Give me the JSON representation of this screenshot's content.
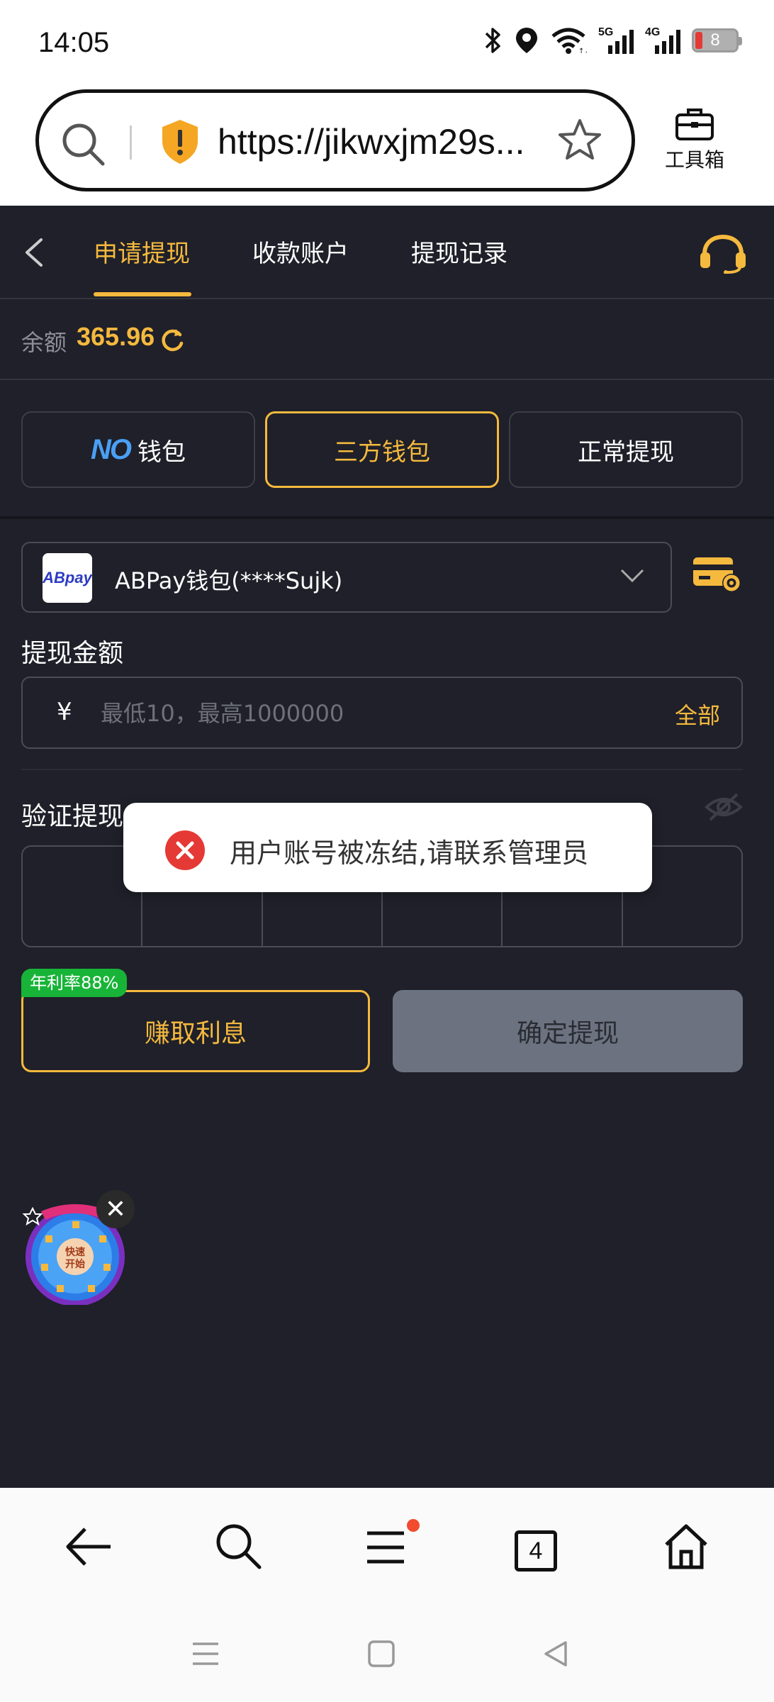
{
  "status_bar": {
    "time": "14:05",
    "battery_level": "8",
    "icons": [
      "bluetooth-icon",
      "location-icon",
      "wifi-icon",
      "5g-signal-icon",
      "4g-signal-icon",
      "battery-icon"
    ]
  },
  "browser": {
    "url": "https://jikwxjm29s...",
    "toolbox_label": "工具箱",
    "tab_count": "4"
  },
  "header": {
    "tabs": [
      {
        "label": "申请提现",
        "active": true
      },
      {
        "label": "收款账户",
        "active": false
      },
      {
        "label": "提现记录",
        "active": false
      }
    ]
  },
  "balance": {
    "label": "余额",
    "value": "365.96"
  },
  "wallet_types": [
    {
      "label": "钱包",
      "logo": "NO",
      "active": false
    },
    {
      "label": "三方钱包",
      "active": true
    },
    {
      "label": "正常提现",
      "active": false
    }
  ],
  "wallet_select": {
    "logo_text": "ABpay",
    "selected": "ABPay钱包(****Sujk)"
  },
  "amount": {
    "label": "提现金额",
    "currency": "¥",
    "placeholder": "最低10，最高1000000",
    "all_label": "全部"
  },
  "verify": {
    "label": "验证提现密码",
    "visible_label": "验证提现"
  },
  "actions": {
    "apr_badge": "年利率88%",
    "earn_label": "赚取利息",
    "confirm_label": "确定提现"
  },
  "toast": {
    "message": "用户账号被冻结,请联系管理员"
  },
  "wheel": {
    "center_text": "快速开始"
  },
  "colors": {
    "accent": "#f5b93e",
    "background": "#1f2029",
    "apr_badge": "#18b438",
    "error": "#e53935",
    "disabled_button": "#6c7280"
  }
}
